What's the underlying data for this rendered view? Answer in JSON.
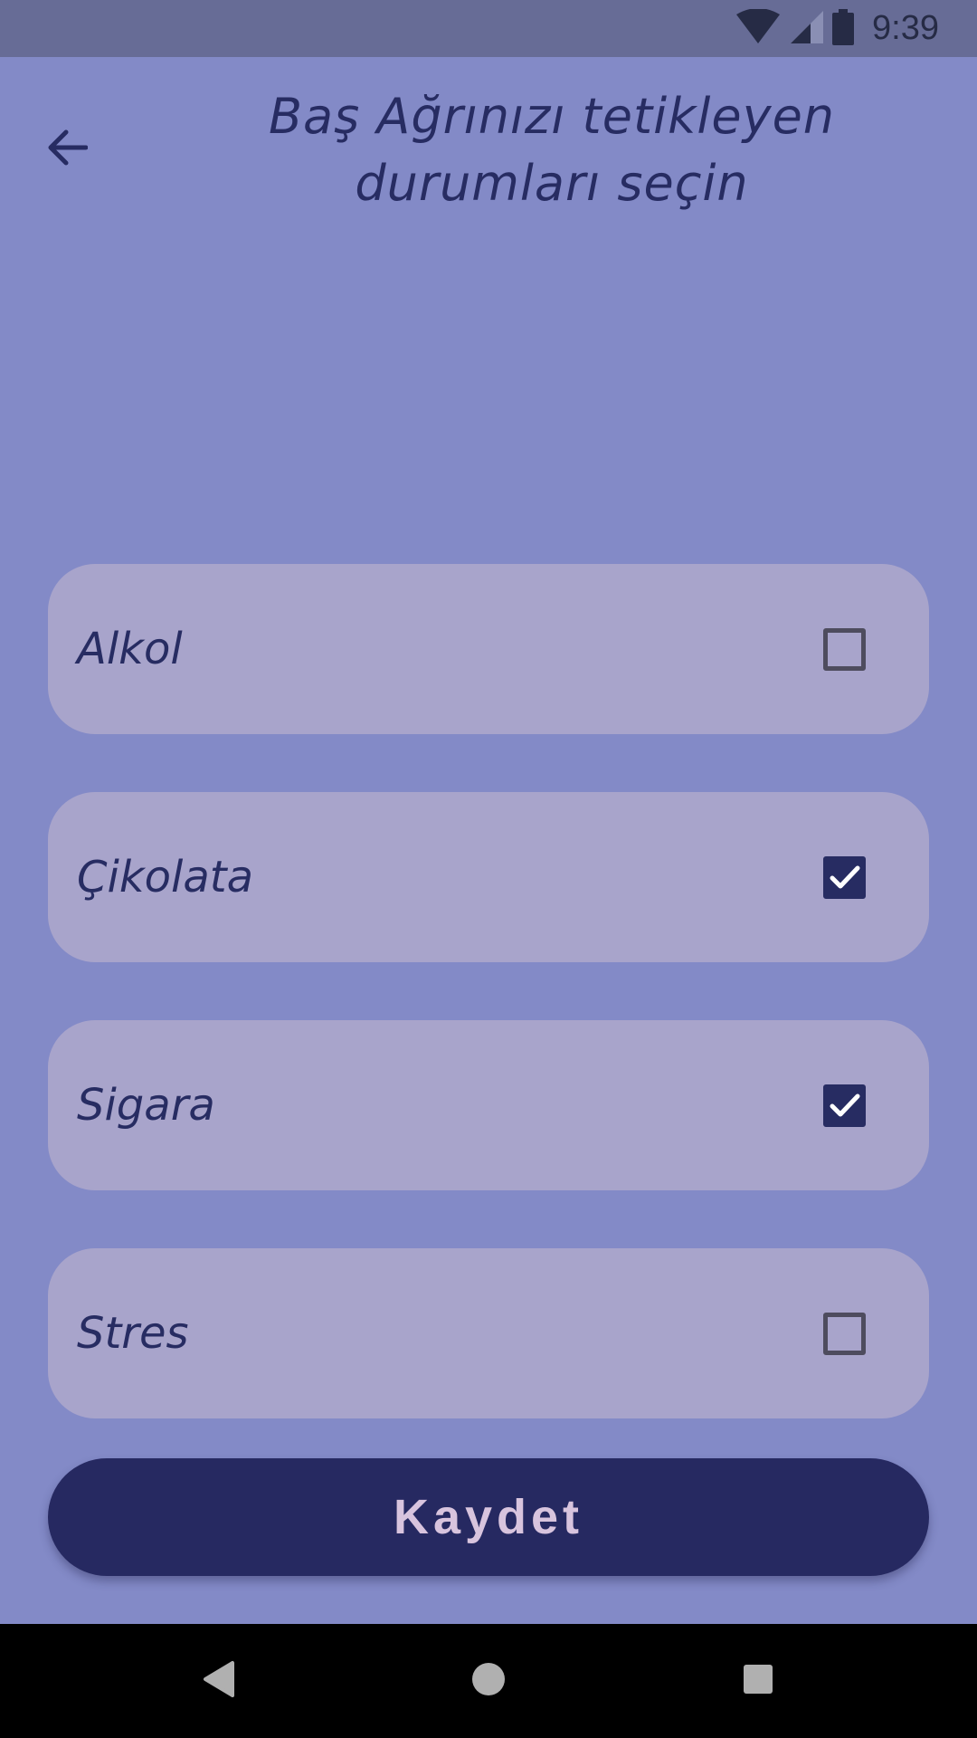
{
  "status_bar": {
    "time": "9:39",
    "icons": [
      "wifi-icon",
      "cell-signal-icon",
      "battery-icon"
    ]
  },
  "header": {
    "back_icon": "arrow-left-icon",
    "title_line1": "Baş Ağrınızı tetikleyen",
    "title_line2": "durumları seçin"
  },
  "triggers": [
    {
      "label": "Alkol",
      "checked": false
    },
    {
      "label": "Çikolata",
      "checked": true
    },
    {
      "label": "Sigara",
      "checked": true
    },
    {
      "label": "Stres",
      "checked": false
    }
  ],
  "save_button": {
    "label": "Kaydet"
  },
  "nav_bar": {
    "icons": [
      "back-triangle-icon",
      "home-circle-icon",
      "recents-square-icon"
    ]
  },
  "colors": {
    "background": "#838AC7",
    "status_bar": "#676C96",
    "card": "#A8A4CB",
    "accent": "#262961",
    "text": "#272C62",
    "button_text": "#D8C4DE"
  }
}
